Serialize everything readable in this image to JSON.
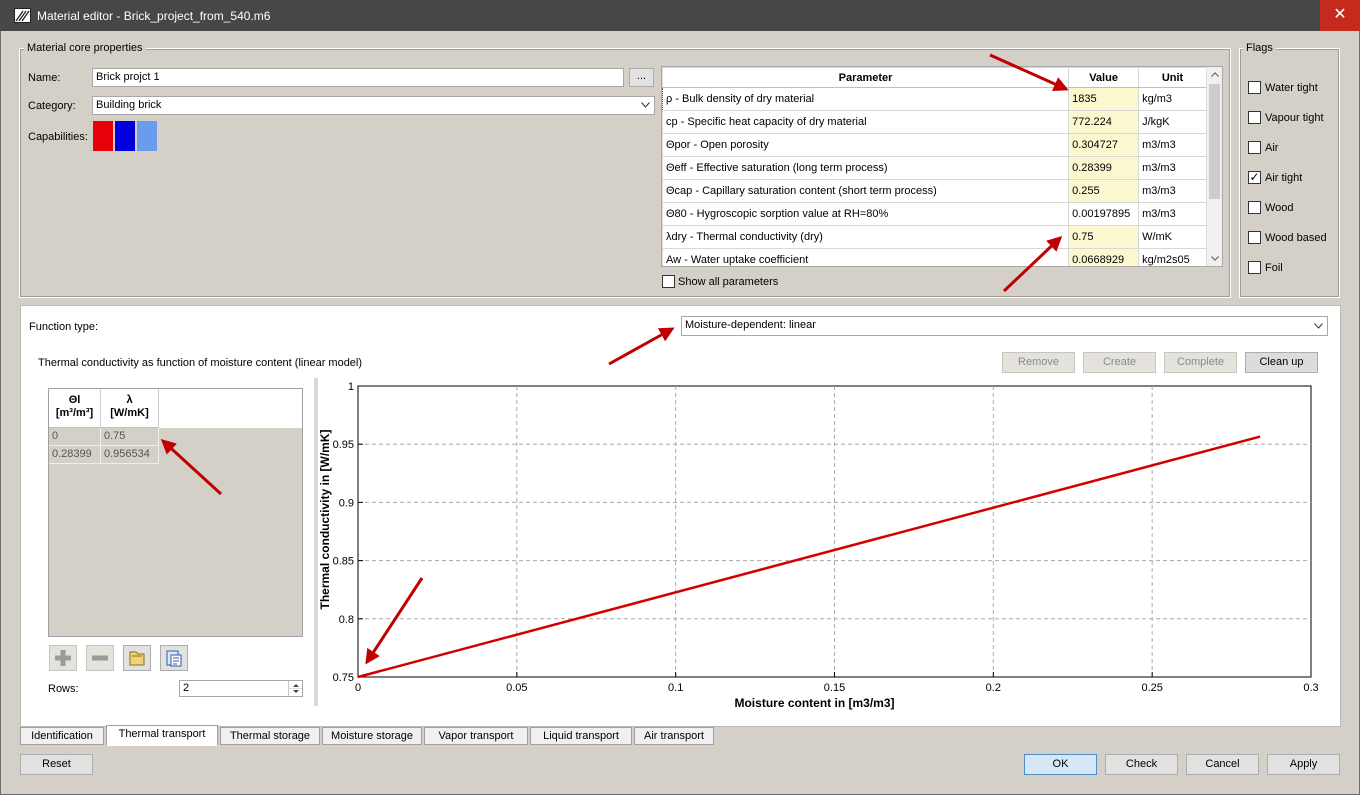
{
  "window": {
    "title": "Material editor - Brick_project_from_540.m6",
    "close_glyph": "✕"
  },
  "core": {
    "group_title": "Material core properties",
    "name_label": "Name:",
    "name_value": "Brick projct 1",
    "browse_label": "...",
    "category_label": "Category:",
    "category_value": "Building brick",
    "capabilities_label": "Capabilities:",
    "capability_colors": [
      "#e8000a",
      "#0000dc",
      "#6a9cee"
    ]
  },
  "params": {
    "headers": [
      "Parameter",
      "Value",
      "Unit"
    ],
    "rows": [
      [
        "ρ - Bulk density of dry material",
        "1835",
        "kg/m3"
      ],
      [
        "cp - Specific heat capacity of dry material",
        "772.224",
        "J/kgK"
      ],
      [
        "Θpor - Open porosity",
        "0.304727",
        "m3/m3"
      ],
      [
        "Θeff - Effective saturation (long term process)",
        "0.28399",
        "m3/m3"
      ],
      [
        "Θcap - Capillary saturation content (short term process)",
        "0.255",
        "m3/m3"
      ],
      [
        "Θ80 - Hygroscopic sorption value at RH=80%",
        "0.00197895",
        "m3/m3"
      ],
      [
        "λdry - Thermal conductivity (dry)",
        "0.75",
        "W/mK"
      ],
      [
        "Aw - Water uptake coefficient",
        "0.0668929",
        "kg/m2s05"
      ]
    ],
    "show_all_label": "Show all parameters"
  },
  "flags": {
    "group_title": "Flags",
    "items": [
      {
        "label": "Water tight",
        "checked": false
      },
      {
        "label": "Vapour tight",
        "checked": false
      },
      {
        "label": "Air",
        "checked": false
      },
      {
        "label": "Air tight",
        "checked": true
      },
      {
        "label": "Wood",
        "checked": false
      },
      {
        "label": "Wood based",
        "checked": false
      },
      {
        "label": "Foil",
        "checked": false
      }
    ]
  },
  "function": {
    "type_label": "Function type:",
    "type_value": "Moisture-dependent: linear",
    "description": "Thermal conductivity as function of moisture content (linear model)",
    "buttons": {
      "remove": "Remove",
      "create": "Create",
      "complete": "Complete",
      "cleanup": "Clean up"
    },
    "table": {
      "col1_line1": "Θl",
      "col1_line2": "[m³/m³]",
      "col2_line1": "λ",
      "col2_line2": "[W/mK]",
      "rows": [
        [
          "0",
          "0.75"
        ],
        [
          "0.28399",
          "0.956534"
        ]
      ]
    },
    "rows_label": "Rows:",
    "rows_value": "2",
    "toolbar_icons": [
      "add-row-icon",
      "remove-row-icon",
      "open-file-icon",
      "paste-icon"
    ]
  },
  "chart_data": {
    "type": "line",
    "title": "",
    "xlabel": "Moisture content in [m3/m3]",
    "ylabel": "Thermal conductivity in [W/mK]",
    "xlim": [
      0,
      0.3
    ],
    "ylim": [
      0.75,
      1
    ],
    "xticks": [
      "0",
      "0.05",
      "0.1",
      "0.15",
      "0.2",
      "0.25",
      "0.3"
    ],
    "yticks": [
      "0.75",
      "0.8",
      "0.85",
      "0.9",
      "0.95",
      "1"
    ],
    "grid": true,
    "series": [
      {
        "x": [
          0,
          0.28399
        ],
        "y": [
          0.75,
          0.956534
        ],
        "color": "#d40000"
      }
    ]
  },
  "tabs": [
    "Identification",
    "Thermal transport",
    "Thermal storage",
    "Moisture storage",
    "Vapor transport",
    "Liquid transport",
    "Air transport"
  ],
  "active_tab": 1,
  "bottom": {
    "reset": "Reset",
    "ok": "OK",
    "check": "Check",
    "cancel": "Cancel",
    "apply": "Apply"
  },
  "colors": {
    "accent_red": "#c42b1c",
    "annotation_arrow": "#c00000",
    "value_highlight": "#fbf8cf"
  }
}
